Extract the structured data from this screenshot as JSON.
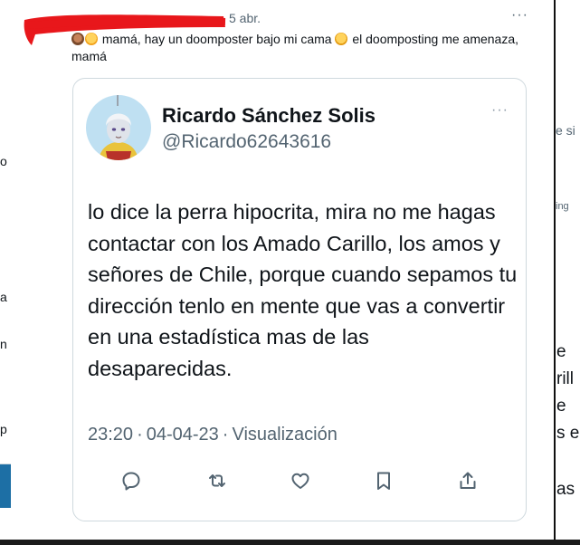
{
  "background": {
    "fragments": [
      {
        "id": "bg-right-1",
        "text": "e si"
      },
      {
        "id": "bg-right-2",
        "text": "ing"
      },
      {
        "id": "bg-left-1",
        "text": "o"
      },
      {
        "id": "bg-left-2",
        "text": "a"
      },
      {
        "id": "bg-left-3",
        "text": "n"
      },
      {
        "id": "bg-left-4",
        "text": "p"
      },
      {
        "id": "bg-right-3",
        "text": "e"
      },
      {
        "id": "bg-right-4",
        "text": "rill"
      },
      {
        "id": "bg-right-5",
        "text": "e"
      },
      {
        "id": "bg-right-6",
        "text": "s en"
      },
      {
        "id": "bg-right-7",
        "text": "as"
      }
    ]
  },
  "tweet": {
    "date": "5 abr.",
    "more": "···",
    "text_part1": " mamá, hay un doomposter bajo mi cama ",
    "text_part2": " el doomposting me amenaza, mamá",
    "emojis": [
      "monkey-face-icon",
      "shushing-face-icon",
      "rofl-face-icon"
    ]
  },
  "quoted": {
    "name": "Ricardo Sánchez Solis",
    "handle": "@Ricardo62643616",
    "more": "···",
    "body": "lo dice la perra hipocrita, mira no me hagas contactar con los Amado Carillo, los amos y señores de Chile, porque cuando sepamos tu dirección tenlo en mente que vas a convertir en una estadística mas de las desaparecidas.",
    "time": "23:20",
    "date": "04-04-23",
    "views": "Visualización",
    "sep": "·"
  },
  "colors": {
    "redaction": "#e8171b",
    "text": "#0f1419",
    "secondary": "#536471",
    "border": "#cfd9de"
  }
}
